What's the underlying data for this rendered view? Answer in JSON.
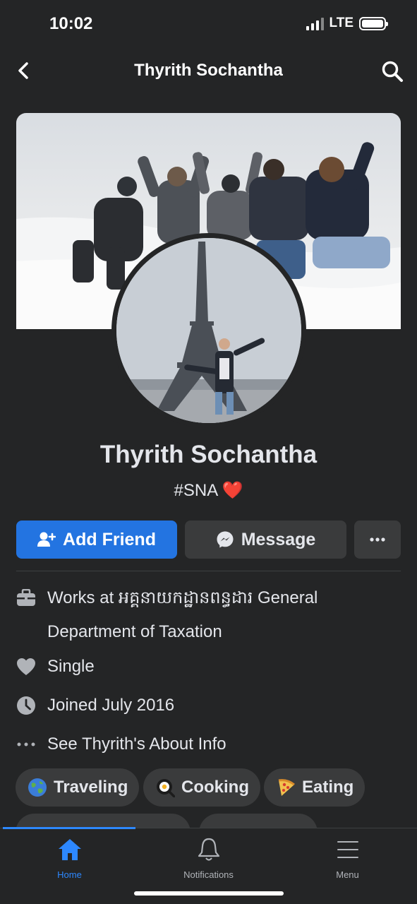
{
  "status_bar": {
    "time": "10:02",
    "network": "LTE"
  },
  "nav": {
    "title": "Thyrith Sochantha",
    "back_icon": "chevron-left-icon",
    "search_icon": "search-icon"
  },
  "profile": {
    "name": "Thyrith Sochantha",
    "bio": "#SNA ❤️",
    "cover_photo": "group-in-snow-photo",
    "profile_photo": "eiffel-tower-photo"
  },
  "actions": {
    "add_friend": "Add Friend",
    "message": "Message",
    "more": "more-icon"
  },
  "intro": {
    "work": "Works at អគ្គនាយកដ្ឋានពន្ធដារ General Department of Taxation",
    "relationship": "Single",
    "joined": "Joined July 2016",
    "about": "See Thyrith's About Info"
  },
  "hobbies": [
    {
      "label": "Traveling",
      "icon": "globe-emoji"
    },
    {
      "label": "Cooking",
      "icon": "egg-pan-emoji"
    },
    {
      "label": "Eating",
      "icon": "pizza-emoji"
    }
  ],
  "tabs": [
    {
      "label": "Home",
      "active": true
    },
    {
      "label": "Notifications",
      "active": false
    },
    {
      "label": "Menu",
      "active": false
    }
  ],
  "colors": {
    "accent": "#2374e1",
    "background": "#242526",
    "surface": "#3a3b3c"
  }
}
